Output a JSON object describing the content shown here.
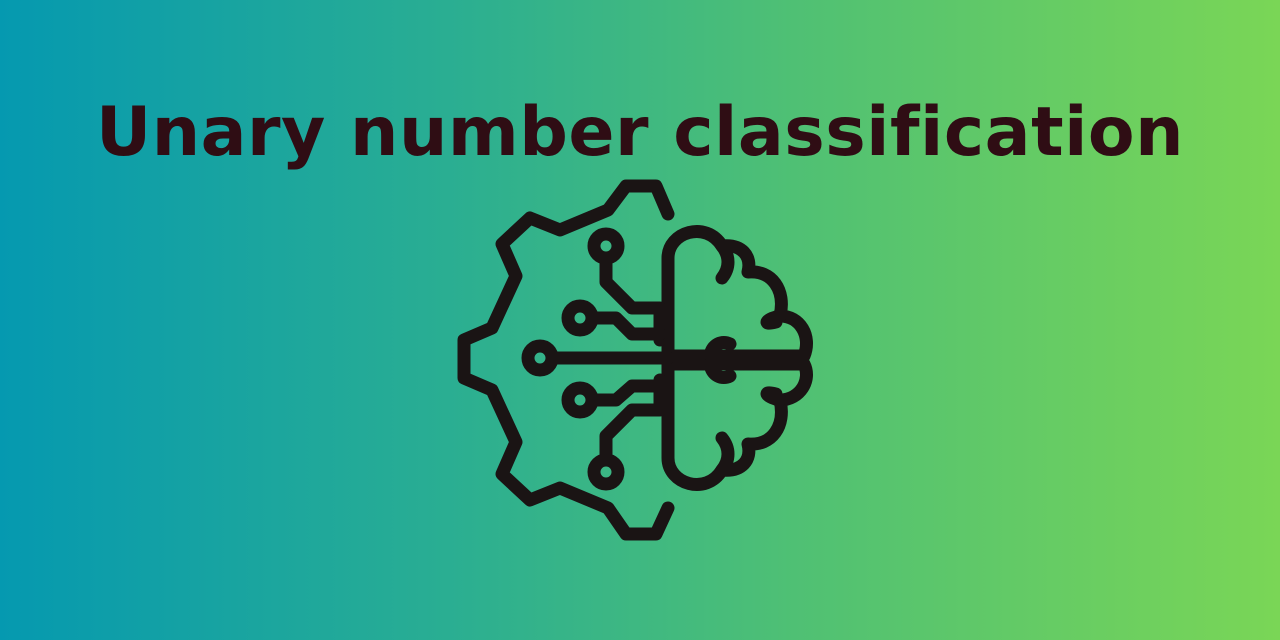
{
  "banner": {
    "title": "Unary number classification",
    "icon": "ai-brain-gear-icon",
    "colors": {
      "gradient_start": "#0599b0",
      "gradient_end": "#7ad656",
      "title_color": "#2f0d14",
      "icon_stroke": "#1a1414"
    }
  }
}
